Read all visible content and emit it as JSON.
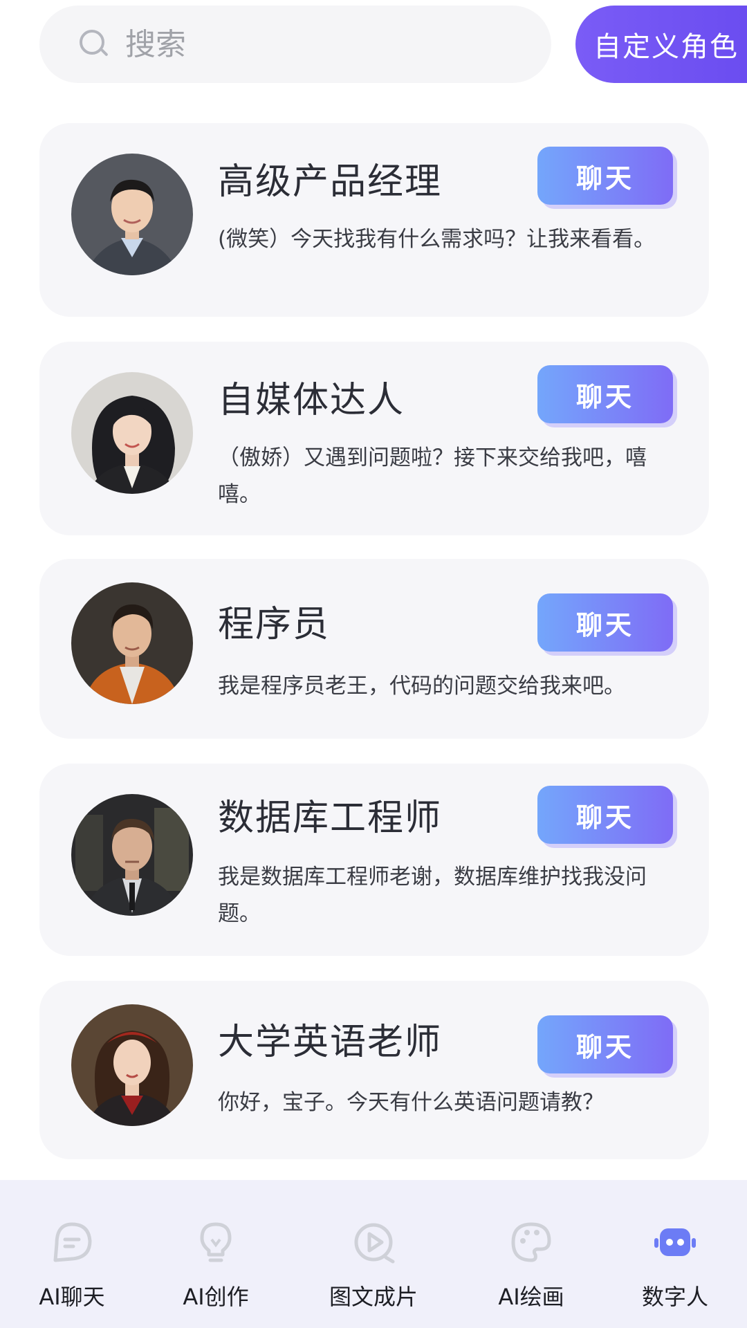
{
  "search": {
    "placeholder": "搜索"
  },
  "custom_role_button": "自定义角色",
  "cards": [
    {
      "title": "高级产品经理",
      "button": "聊天",
      "description": "(微笑）今天找我有什么需求吗？让我来看看。"
    },
    {
      "title": "自媒体达人",
      "button": "聊天",
      "description": "（傲娇）又遇到问题啦？接下来交给我吧，嘻嘻。"
    },
    {
      "title": "程序员",
      "button": "聊天",
      "description": "我是程序员老王，代码的问题交给我来吧。"
    },
    {
      "title": "数据库工程师",
      "button": "聊天",
      "description": "我是数据库工程师老谢，数据库维护找我没问题。"
    },
    {
      "title": "大学英语老师",
      "button": "聊天",
      "description": "你好，宝子。今天有什么英语问题请教？"
    }
  ],
  "bottom_nav": [
    {
      "label": "AI聊天",
      "icon": "chat-icon"
    },
    {
      "label": "AI创作",
      "icon": "lightbulb-icon"
    },
    {
      "label": "图文成片",
      "icon": "play-icon"
    },
    {
      "label": "AI绘画",
      "icon": "palette-icon"
    },
    {
      "label": "数字人",
      "icon": "robot-icon",
      "active": true
    }
  ],
  "colors": {
    "accent": "#7a5cf6",
    "chat_button_start": "#74a6fb",
    "chat_button_end": "#7f6cf6",
    "nav_inactive": "#cfd1d8",
    "card_bg": "#f6f6f9"
  }
}
